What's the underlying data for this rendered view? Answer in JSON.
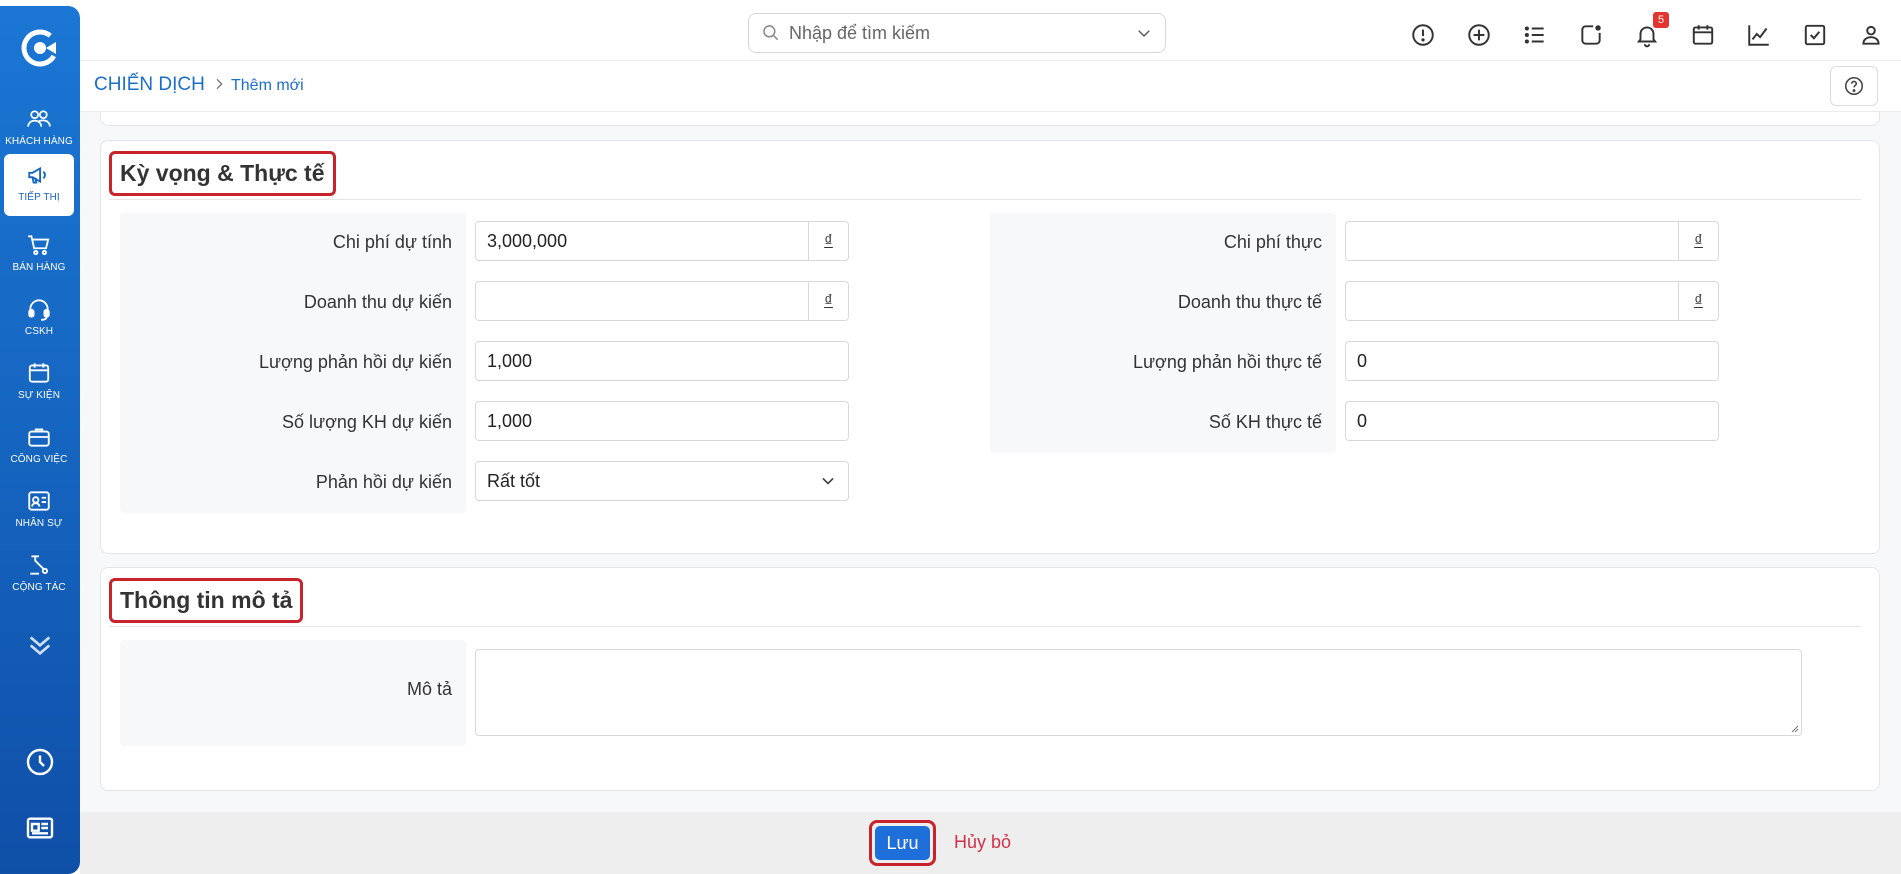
{
  "sidebar": {
    "items": [
      {
        "label": "KHÁCH HÀNG",
        "icon": "users-icon"
      },
      {
        "label": "TIẾP THỊ",
        "icon": "megaphone-icon",
        "active": true
      },
      {
        "label": "BÁN HÀNG",
        "icon": "cart-icon"
      },
      {
        "label": "CSKH",
        "icon": "headset-icon"
      },
      {
        "label": "SỰ KIỆN",
        "icon": "calendar-icon"
      },
      {
        "label": "CÔNG VIỆC",
        "icon": "briefcase-icon"
      },
      {
        "label": "NHÂN SỰ",
        "icon": "id-card-icon"
      },
      {
        "label": "CỘNG TÁC",
        "icon": "workflow-icon"
      }
    ]
  },
  "topbar": {
    "search_placeholder": "Nhập để tìm kiếm",
    "notification_count": "5"
  },
  "breadcrumb": {
    "root": "CHIẾN DỊCH",
    "current": "Thêm mới"
  },
  "section_expect": {
    "title": "Kỳ vọng & Thực tế",
    "left": {
      "est_cost_label": "Chi phí dự tính",
      "est_cost_value": "3,000,000",
      "est_revenue_label": "Doanh thu dự kiến",
      "est_revenue_value": "",
      "est_responses_label": "Lượng phản hồi dự kiến",
      "est_responses_value": "1,000",
      "est_customers_label": "Số lượng KH dự kiến",
      "est_customers_value": "1,000",
      "est_feedback_label": "Phản hồi dự kiến",
      "est_feedback_value": "Rất tốt"
    },
    "right": {
      "act_cost_label": "Chi phí thực",
      "act_cost_value": "",
      "act_revenue_label": "Doanh thu thực tế",
      "act_revenue_value": "",
      "act_responses_label": "Lượng phản hồi thực tế",
      "act_responses_value": "0",
      "act_customers_label": "Số KH thực tế",
      "act_customers_value": "0"
    },
    "currency": "₫"
  },
  "section_desc": {
    "title": "Thông tin mô tả",
    "desc_label": "Mô tả",
    "desc_value": ""
  },
  "footer": {
    "save_label": "Lưu",
    "cancel_label": "Hủy bỏ"
  },
  "colors": {
    "primary": "#1b6fc9",
    "sidebar": "#1565c0",
    "highlight": "#c8222b",
    "cancel": "#d0324a"
  }
}
